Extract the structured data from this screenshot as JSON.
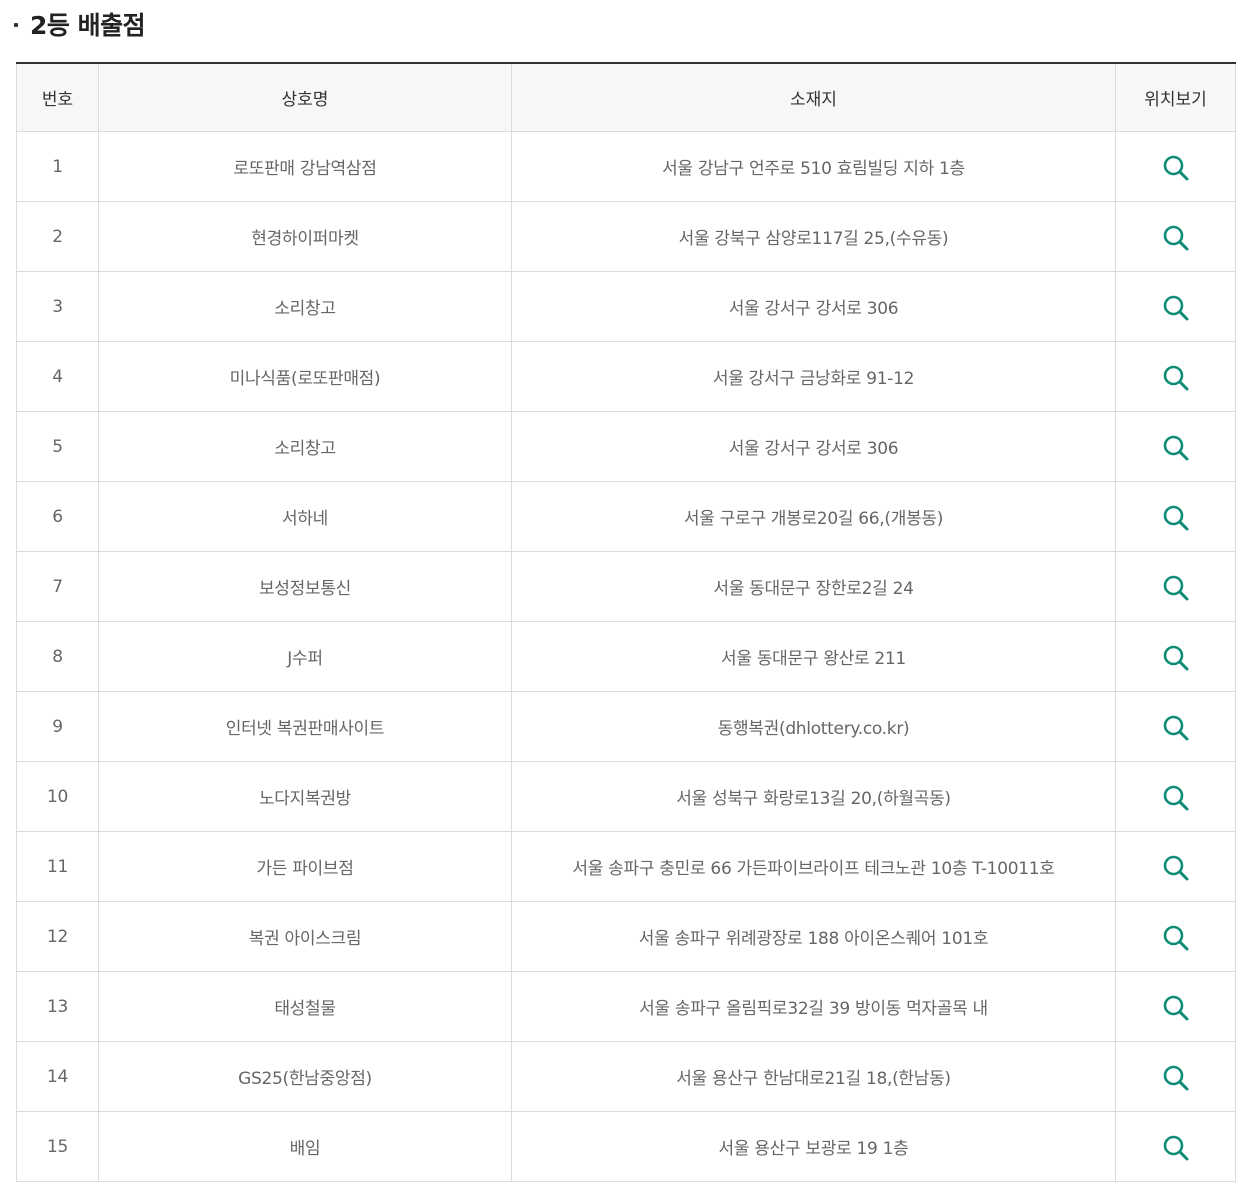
{
  "section": {
    "title": "2등 배출점"
  },
  "colors": {
    "accent": "#0f8c76",
    "header_bg": "#f7f7f7",
    "border": "#dcdcdc",
    "top_border": "#333333"
  },
  "table": {
    "headers": {
      "num": "번호",
      "name": "상호명",
      "address": "소재지",
      "map": "위치보기"
    },
    "map_icon": "search-icon",
    "rows": [
      {
        "num": "1",
        "name": "로또판매 강남역삼점",
        "address": "서울 강남구 언주로 510 효림빌딩 지하 1층"
      },
      {
        "num": "2",
        "name": "현경하이퍼마켓",
        "address": "서울 강북구 삼양로117길 25,(수유동)"
      },
      {
        "num": "3",
        "name": "소리창고",
        "address": "서울 강서구 강서로 306"
      },
      {
        "num": "4",
        "name": "미나식품(로또판매점)",
        "address": "서울 강서구 금낭화로 91-12"
      },
      {
        "num": "5",
        "name": "소리창고",
        "address": "서울 강서구 강서로 306"
      },
      {
        "num": "6",
        "name": "서하네",
        "address": "서울 구로구 개봉로20길 66,(개봉동)"
      },
      {
        "num": "7",
        "name": "보성정보통신",
        "address": "서울 동대문구 장한로2길 24"
      },
      {
        "num": "8",
        "name": "J수퍼",
        "address": "서울 동대문구 왕산로 211"
      },
      {
        "num": "9",
        "name": "인터넷 복권판매사이트",
        "address": "동행복권(dhlottery.co.kr)"
      },
      {
        "num": "10",
        "name": "노다지복권방",
        "address": "서울 성북구 화랑로13길 20,(하월곡동)"
      },
      {
        "num": "11",
        "name": "가든 파이브점",
        "address": "서울 송파구 충민로 66 가든파이브라이프 테크노관 10층 T-10011호"
      },
      {
        "num": "12",
        "name": "복권 아이스크림",
        "address": "서울 송파구 위례광장로 188 아이온스퀘어 101호"
      },
      {
        "num": "13",
        "name": "태성철물",
        "address": "서울 송파구 올림픽로32길 39 방이동 먹자골목 내"
      },
      {
        "num": "14",
        "name": "GS25(한남중앙점)",
        "address": "서울 용산구 한남대로21길 18,(한남동)"
      },
      {
        "num": "15",
        "name": "배임",
        "address": "서울 용산구 보광로 19 1층"
      }
    ]
  }
}
